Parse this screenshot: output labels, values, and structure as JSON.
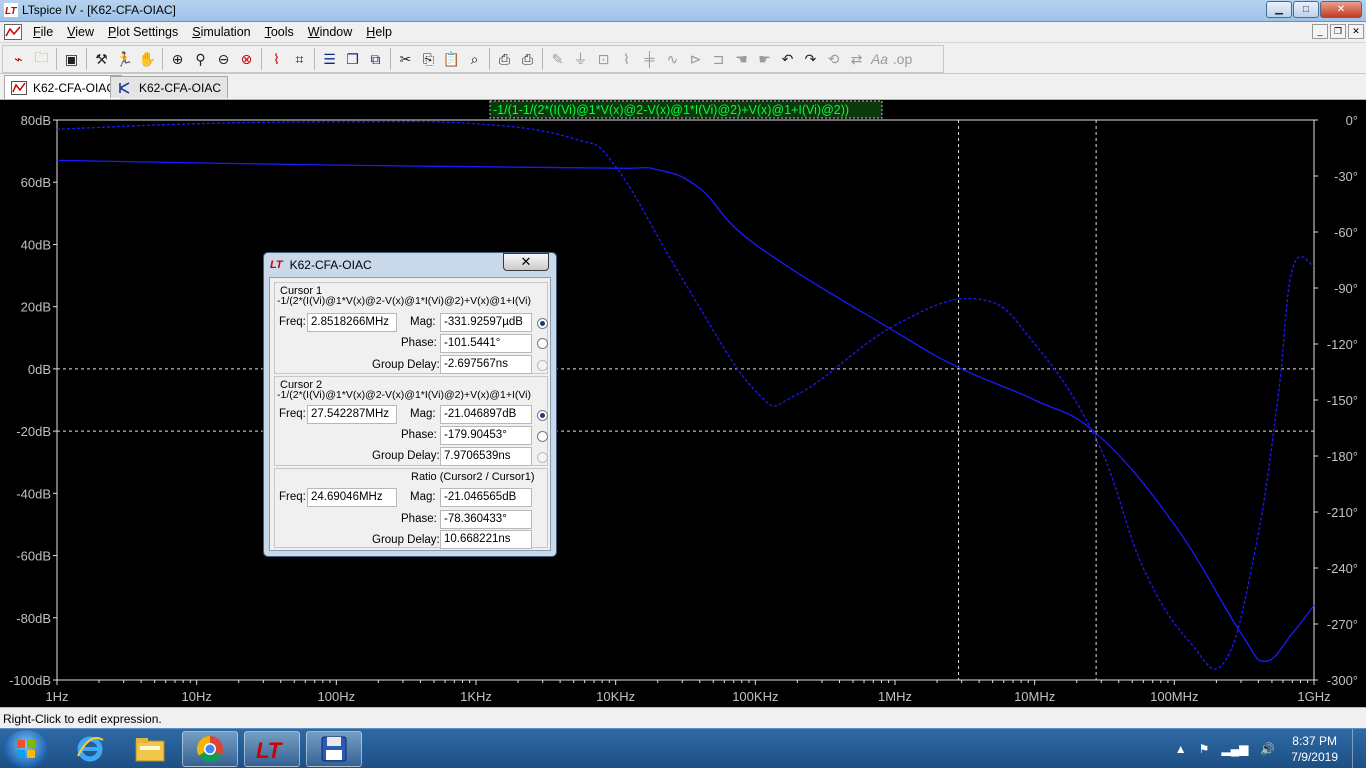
{
  "window": {
    "title": "LTspice IV - [K62-CFA-OIAC]",
    "buttons": {
      "minimize": "▁",
      "maximize": "□",
      "close": "✕"
    },
    "mdi_buttons": {
      "minimize": "_",
      "restore": "❐",
      "close": "✕"
    }
  },
  "menu": [
    "File",
    "View",
    "Plot Settings",
    "Simulation",
    "Tools",
    "Window",
    "Help"
  ],
  "tabs": [
    {
      "label": "K62-CFA-OIAC",
      "icon": "waveform-icon",
      "active": true
    },
    {
      "label": "K62-CFA-OIAC",
      "icon": "schematic-icon",
      "active": false
    }
  ],
  "plot": {
    "trace_label": "-1/(1-1/(2*(I(Vi)@1*V(x)@2-V(x)@1*I(Vi)@2)+V(x)@1+I(Vi)@2))",
    "left_ticks": [
      "80dB",
      "60dB",
      "40dB",
      "20dB",
      "0dB",
      "-20dB",
      "-40dB",
      "-60dB",
      "-80dB",
      "-100dB"
    ],
    "right_ticks": [
      "0°",
      "-30°",
      "-60°",
      "-90°",
      "-120°",
      "-150°",
      "-180°",
      "-210°",
      "-240°",
      "-270°",
      "-300°"
    ],
    "x_ticks": [
      "1Hz",
      "10Hz",
      "100Hz",
      "1KHz",
      "10KHz",
      "100KHz",
      "1MHz",
      "10MHz",
      "100MHz",
      "1GHz"
    ],
    "colors": {
      "trace": "#1a1aff",
      "grid": "#e0e0e0",
      "label": "#00ff40",
      "background": "#000000",
      "axis_text": "#c0c0c0"
    }
  },
  "chart_data": {
    "type": "line",
    "title": "-1/(1-1/(2*(I(Vi)@1*V(x)@2-V(x)@1*I(Vi)@2)+V(x)@1+I(Vi)@2))",
    "x_scale": "log",
    "xlim_hz": [
      1,
      1000000000
    ],
    "ylim_left_db": [
      -100,
      80
    ],
    "ylim_right_deg": [
      -300,
      0
    ],
    "grid": "dashed at 0dB and -20dB",
    "cursors_hz": [
      2851826,
      27542287
    ],
    "series": [
      {
        "style": "solid",
        "axis": "left",
        "points": [
          [
            1,
            67
          ],
          [
            100,
            65.5
          ],
          [
            1000,
            65
          ],
          [
            10000,
            64.5
          ],
          [
            20000,
            64
          ],
          [
            40000,
            58
          ],
          [
            100000,
            40
          ],
          [
            1000000,
            12
          ],
          [
            3000000,
            0
          ],
          [
            10000000,
            -10
          ],
          [
            28000000,
            -21
          ],
          [
            100000000,
            -50
          ],
          [
            300000000,
            -85
          ],
          [
            450000000,
            -94
          ],
          [
            700000000,
            -85
          ],
          [
            1000000000,
            -76
          ]
        ]
      },
      {
        "style": "dashed",
        "axis": "right",
        "points": [
          [
            1,
            -5
          ],
          [
            10,
            -2
          ],
          [
            100,
            -1
          ],
          [
            1000,
            -2
          ],
          [
            5000,
            -10
          ],
          [
            10000,
            -25
          ],
          [
            30000,
            -85
          ],
          [
            100000,
            -145
          ],
          [
            200000,
            -147
          ],
          [
            1000000,
            -110
          ],
          [
            4000000,
            -96
          ],
          [
            10000000,
            -120
          ],
          [
            28000000,
            -172
          ],
          [
            60000000,
            -240
          ],
          [
            130000000,
            -280
          ],
          [
            230000000,
            -290
          ],
          [
            380000000,
            -230
          ],
          [
            550000000,
            -150
          ],
          [
            700000000,
            -80
          ],
          [
            1000000000,
            -78
          ]
        ]
      }
    ]
  },
  "cursor_dialog": {
    "title": "K62-CFA-OIAC",
    "close": "✕",
    "cursor1": {
      "heading": "Cursor 1",
      "expr": "-1/(2*(I(Vi)@1*V(x)@2-V(x)@1*I(Vi)@2)+V(x)@1+I(Vi)",
      "freq_label": "Freq:",
      "freq": "2.8518266MHz",
      "mag_label": "Mag:",
      "mag": "-331.92597µdB",
      "phase_label": "Phase:",
      "phase": "-101.5441°",
      "gd_label": "Group Delay:",
      "gd": "-2.697567ns"
    },
    "cursor2": {
      "heading": "Cursor 2",
      "expr": "-1/(2*(I(Vi)@1*V(x)@2-V(x)@1*I(Vi)@2)+V(x)@1+I(Vi)",
      "freq_label": "Freq:",
      "freq": "27.542287MHz",
      "mag_label": "Mag:",
      "mag": "-21.046897dB",
      "phase_label": "Phase:",
      "phase": "-179.90453°",
      "gd_label": "Group Delay:",
      "gd": "7.9706539ns"
    },
    "ratio": {
      "heading": "Ratio (Cursor2 / Cursor1)",
      "freq_label": "Freq:",
      "freq": "24.69046MHz",
      "mag_label": "Mag:",
      "mag": "-21.046565dB",
      "phase_label": "Phase:",
      "phase": "-78.360433°",
      "gd_label": "Group Delay:",
      "gd": "10.668221ns"
    }
  },
  "status": "Right-Click to edit expression.",
  "taskbar": {
    "apps": [
      "internet-explorer-icon",
      "file-explorer-icon",
      "chrome-icon",
      "ltspice-icon",
      "floppy-save-icon"
    ],
    "time": "8:37 PM",
    "date": "7/9/2019"
  }
}
